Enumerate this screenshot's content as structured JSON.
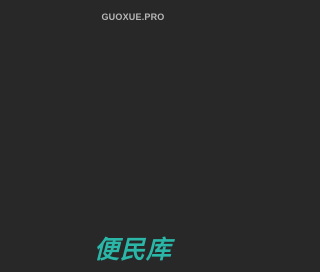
{
  "header": {
    "site_domain": "GUOXUE.PRO"
  },
  "footer": {
    "logo_text": "便民库"
  },
  "colors": {
    "background": "#282828",
    "domain_text": "#b7b7b7",
    "logo_accent": "#2bb7a8"
  }
}
